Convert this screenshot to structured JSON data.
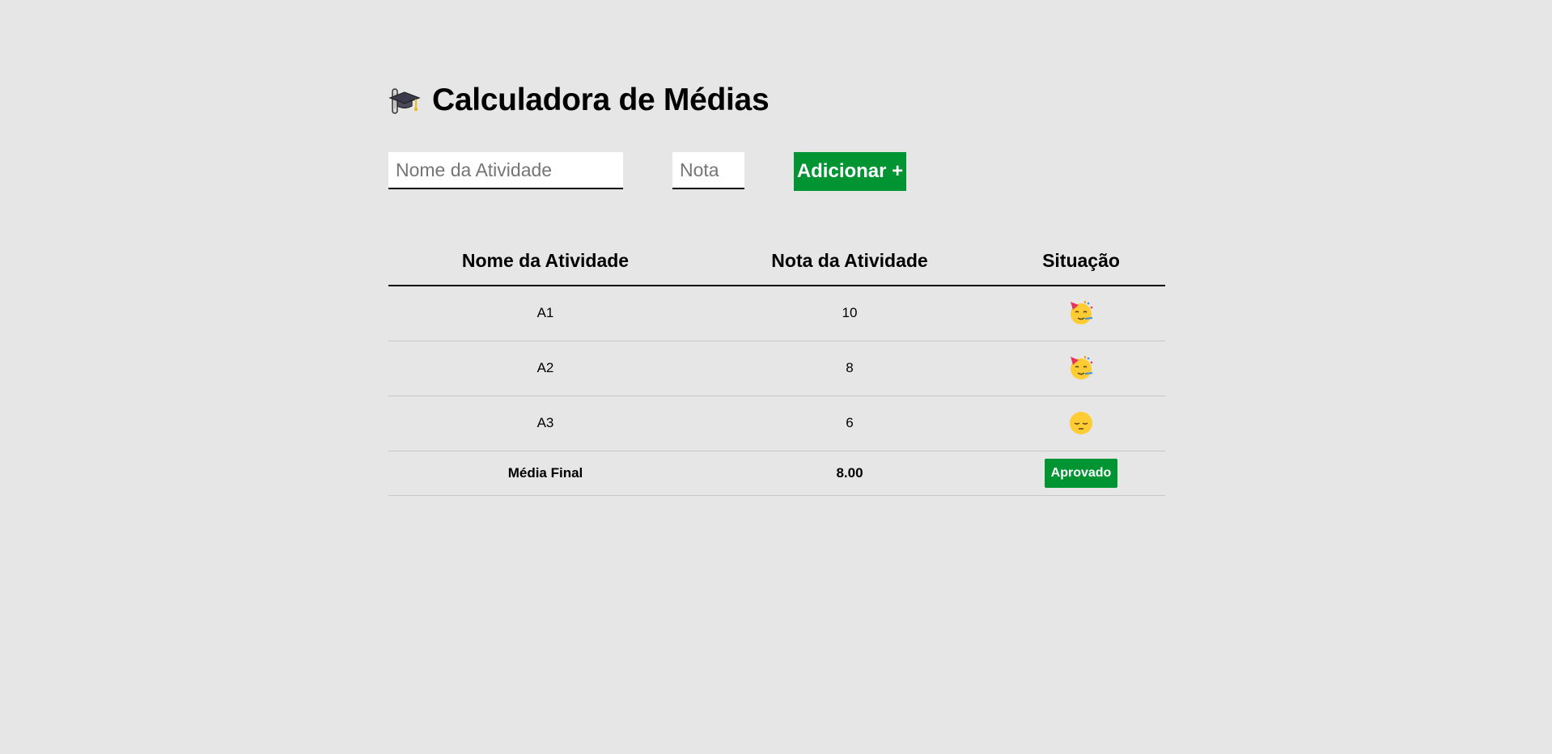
{
  "header": {
    "icon": "graduation-cap-icon",
    "title": "Calculadora de Médias"
  },
  "form": {
    "name_placeholder": "Nome da Atividade",
    "name_value": "",
    "grade_placeholder": "Nota",
    "grade_value": "",
    "add_label": "Adicionar +"
  },
  "table": {
    "headers": [
      "Nome da Atividade",
      "Nota da Atividade",
      "Situação"
    ],
    "rows": [
      {
        "name": "A1",
        "grade": "10",
        "status_icon": "party-face-icon"
      },
      {
        "name": "A2",
        "grade": "8",
        "status_icon": "party-face-icon"
      },
      {
        "name": "A3",
        "grade": "6",
        "status_icon": "pensive-face-icon"
      }
    ],
    "footer": {
      "label": "Média Final",
      "average": "8.00",
      "result": "Aprovado"
    }
  },
  "colors": {
    "background": "#e6e6e6",
    "accent_green": "#009432"
  }
}
